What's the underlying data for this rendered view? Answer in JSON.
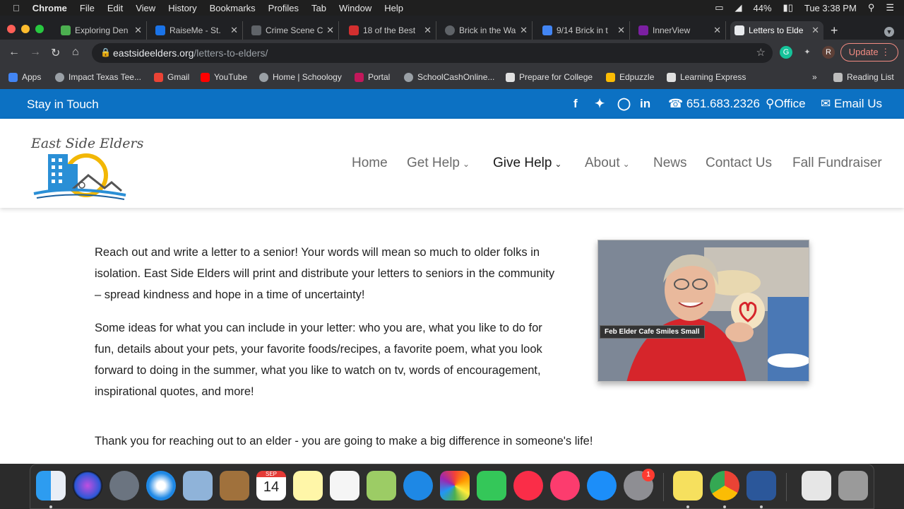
{
  "menubar": {
    "app": "Chrome",
    "items": [
      "File",
      "Edit",
      "View",
      "History",
      "Bookmarks",
      "Profiles",
      "Tab",
      "Window",
      "Help"
    ],
    "battery": "44%",
    "clock": "Tue 3:38 PM"
  },
  "tabs": [
    {
      "label": "Exploring Den",
      "color": "#4caf50"
    },
    {
      "label": "RaiseMe - St.",
      "color": "#1a73e8"
    },
    {
      "label": "Crime Scene C",
      "color": "#5f6368"
    },
    {
      "label": "18 of the Best",
      "color": "#d32f2f"
    },
    {
      "label": "Brick in the Wa",
      "color": "#5f6368"
    },
    {
      "label": "9/14 Brick in t",
      "color": "#4285f4"
    },
    {
      "label": "InnerView",
      "color": "#7b1fa2"
    },
    {
      "label": "Letters to Elde",
      "color": "#e8eaed"
    }
  ],
  "address": {
    "host": "eastsideelders.org",
    "path": "/letters-to-elders/"
  },
  "update_label": "Update",
  "profile_initial": "R",
  "bookmarks": [
    {
      "label": "Apps",
      "color": "#4285f4"
    },
    {
      "label": "Impact Texas Tee...",
      "color": "#9aa0a6"
    },
    {
      "label": "Gmail",
      "color": "#ea4335"
    },
    {
      "label": "YouTube",
      "color": "#ff0000"
    },
    {
      "label": "Home | Schoology",
      "color": "#9aa0a6"
    },
    {
      "label": "Portal",
      "color": "#c2185b"
    },
    {
      "label": "SchoolCashOnline...",
      "color": "#9aa0a6"
    },
    {
      "label": "Prepare for College",
      "color": "#e0e0e0"
    },
    {
      "label": "Edpuzzle",
      "color": "#fbbc04"
    },
    {
      "label": "Learning Express",
      "color": "#e0e0e0"
    }
  ],
  "bookmarks_more": "»",
  "reading_list": "Reading List",
  "site": {
    "topbar": {
      "stay": "Stay in Touch",
      "phone": "651.683.2326",
      "office": "Office",
      "email": "Email Us"
    },
    "logo_text": "East Side Elders",
    "nav": [
      {
        "label": "Home",
        "chevron": false,
        "active": false
      },
      {
        "label": "Get Help",
        "chevron": true,
        "active": false
      },
      {
        "label": "Give Help",
        "chevron": true,
        "active": true
      },
      {
        "label": "About",
        "chevron": true,
        "active": false
      },
      {
        "label": "News",
        "chevron": false,
        "active": false
      },
      {
        "label": "Contact Us",
        "chevron": false,
        "active": false
      },
      {
        "label": "Fall Fundraiser",
        "chevron": false,
        "active": false
      }
    ],
    "paragraph1": "Reach out and write a letter to a senior!  Your words will mean so much to older folks in isolation.  East Side Elders will print and distribute your letters to seniors in the community – spread kindness and hope in a time of uncertainty!",
    "paragraph2": "Some ideas for what you can include in your letter:  who you are, what you like to do for fun, details about your pets, your favorite foods/recipes, a favorite poem, what you look forward to doing in the summer, what you like to watch on tv, words of encouragement, inspirational quotes, and more!",
    "thanks": "Thank you for reaching out to an elder - you are going to make a big difference in someone's life!",
    "photo_caption": "Feb Elder Cafe Smiles Small"
  },
  "dock": {
    "calendar_month": "SEP",
    "calendar_day": "14",
    "settings_badge": "1"
  }
}
